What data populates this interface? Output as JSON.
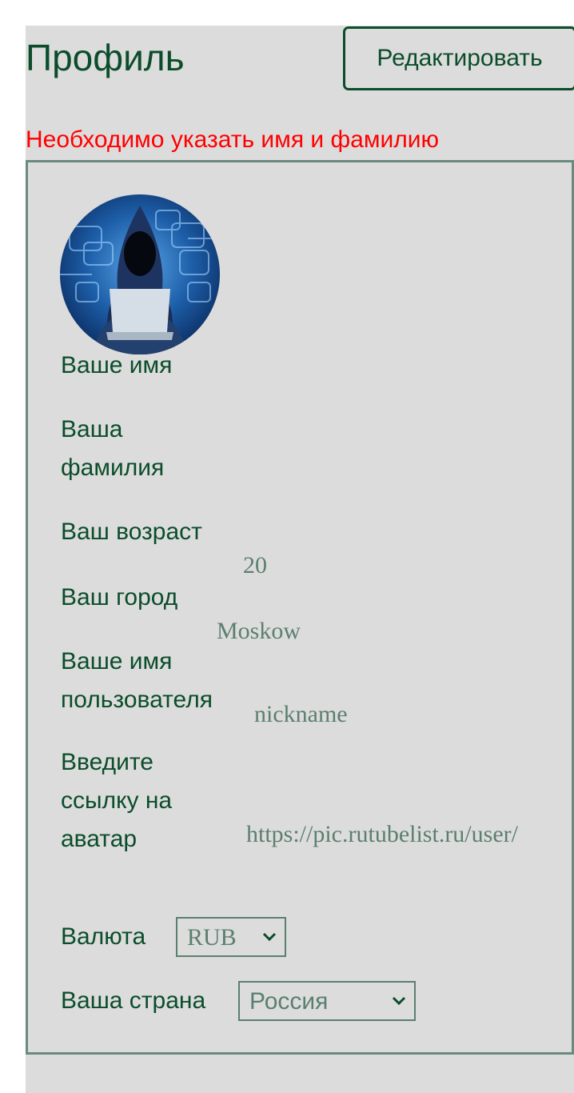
{
  "header": {
    "title": "Профиль",
    "edit_label": "Редактировать"
  },
  "error_message": "Необходимо указать имя и фамилию",
  "profile": {
    "avatar_icon": "hooded-hacker-avatar",
    "first_name": {
      "label": "Ваше имя",
      "value": ""
    },
    "last_name": {
      "label_line1": "Ваша",
      "label_line2": "фамилия",
      "value": ""
    },
    "age": {
      "label": "Ваш возраст",
      "value": "20"
    },
    "city": {
      "label": "Ваш город",
      "value": "Moskow"
    },
    "username": {
      "label_line1": "Ваше имя",
      "label_line2": "пользователя",
      "value": "nickname"
    },
    "avatar_link": {
      "label_line1": "Введите",
      "label_line2": "ссылку на",
      "label_line3": "аватар",
      "value": "https://pic.rutubelist.ru/user/"
    },
    "currency": {
      "label": "Валюта",
      "selected": "RUB"
    },
    "country": {
      "label": "Ваша страна",
      "selected": "Россия"
    }
  },
  "colors": {
    "accent": "#0b4d2a",
    "error": "#ff0000",
    "panel": "#dcdcdc",
    "value_text": "#5b7f6f"
  }
}
